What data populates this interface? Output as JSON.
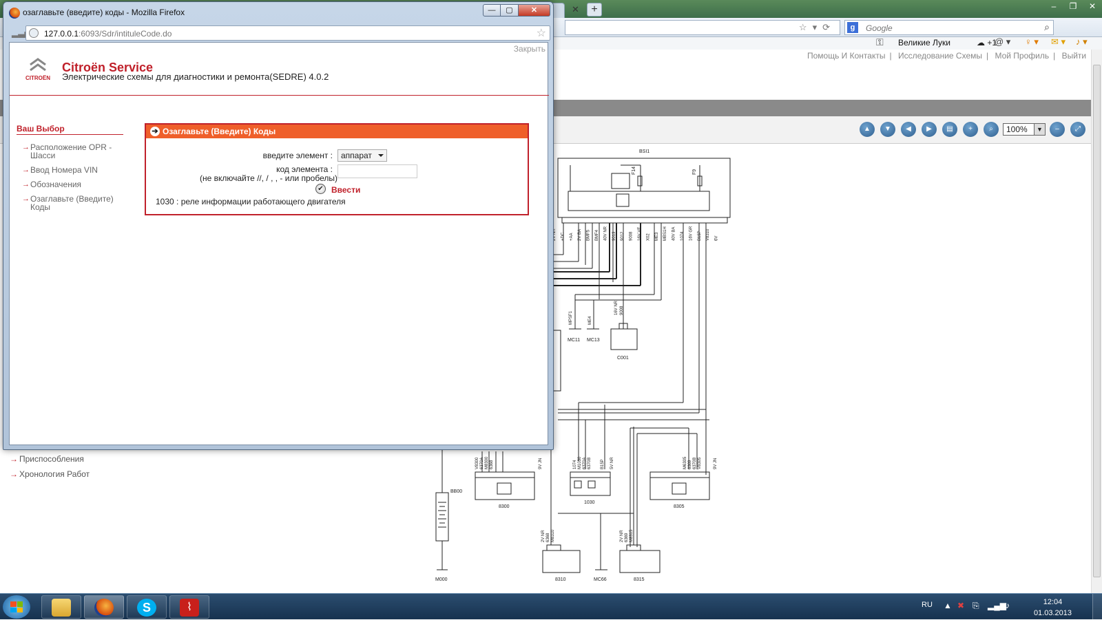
{
  "popup": {
    "title": "озаглавьте (введите) коды - Mozilla Firefox",
    "url_host": "127.0.0.1",
    "url_rest": ":6093/Sdr/intituleCode.do",
    "close_link": "Закрыть",
    "brand": "Citroën Service",
    "brand_logo_text": "CITROËN",
    "subtitle": "Электрические схемы для диагностики и ремонта(SEDRE) 4.0.2",
    "sidebar": {
      "title": "Ваш Выбор",
      "items": [
        "Расположение OPR - Шасси",
        "Ввод Номера VIN",
        "Обозначения",
        "Озаглавьте (Введите) Коды"
      ]
    },
    "panel": {
      "title": "Озаглавьте (Введите) Коды",
      "element_label": "введите элемент :",
      "element_value": "аппарат",
      "code_label": "код элемента :",
      "code_hint": "(не включайте //, / , , - или пробелы)",
      "code_value": "",
      "submit_label": "Ввести",
      "result": "1030 : реле информации работающего двигателя"
    }
  },
  "background": {
    "search_placeholder": "Google",
    "city": "Великие Луки",
    "temperature": "+1",
    "top_links": [
      "Помощь И Контакты",
      "Исследование Схемы",
      "Мой Профиль",
      "Выйти"
    ],
    "zoom": "100%",
    "left_links": [
      "Приспособления",
      "Хронология Работ"
    ]
  },
  "schematic": {
    "connectors": [
      "BSI1",
      "C001",
      "MC11",
      "MC13",
      "BB00",
      "8300",
      "1030",
      "8305",
      "8310",
      "8315",
      "MC66",
      "M000"
    ],
    "fuses": [
      "F14",
      "F9"
    ],
    "wire_labels_top": [
      "2V NR",
      "+DC",
      "+AA",
      "2V BA",
      "BMF5",
      "BMF4",
      "40V NR",
      "9013",
      "9012",
      "9008",
      "16V VE",
      "X02",
      "ME3",
      "MBS1H",
      "40V BA",
      "1074",
      "16V GR",
      "B15P",
      "V8310",
      "6V"
    ],
    "wire_labels_bottom": [
      "V8300",
      "6370A",
      "M8300",
      "6368",
      "9V JN",
      "1074",
      "M1030",
      "6370A",
      "6370B",
      "B15P",
      "5V NR",
      "M6305",
      "6369",
      "6370B",
      "V8305",
      "9V JN",
      "2V NR",
      "6368",
      "M8310",
      "2V NR",
      "6369",
      "M8315",
      "MPSF1",
      "ME4",
      "16V NR",
      "9008"
    ]
  },
  "taskbar": {
    "lang": "RU",
    "time": "12:04",
    "date": "01.03.2013"
  },
  "colors": {
    "brand_red": "#c0202a",
    "panel_header": "#ef5f2a"
  }
}
